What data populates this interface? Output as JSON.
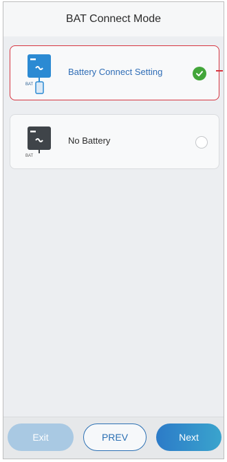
{
  "header": {
    "title": "BAT Connect Mode"
  },
  "options": [
    {
      "label": "Battery Connect Setting",
      "selected": true,
      "icon": "inverter-battery-icon",
      "icon_text": "BAT"
    },
    {
      "label": "No Battery",
      "selected": false,
      "icon": "inverter-no-battery-icon",
      "icon_text": "BAT"
    }
  ],
  "footer": {
    "exit_label": "Exit",
    "prev_label": "PREV",
    "next_label": "Next"
  },
  "colors": {
    "accent": "#2a6fb3",
    "selected_border": "#d6343f",
    "check": "#43a63a",
    "exit_disabled": "#a9c9e3"
  }
}
